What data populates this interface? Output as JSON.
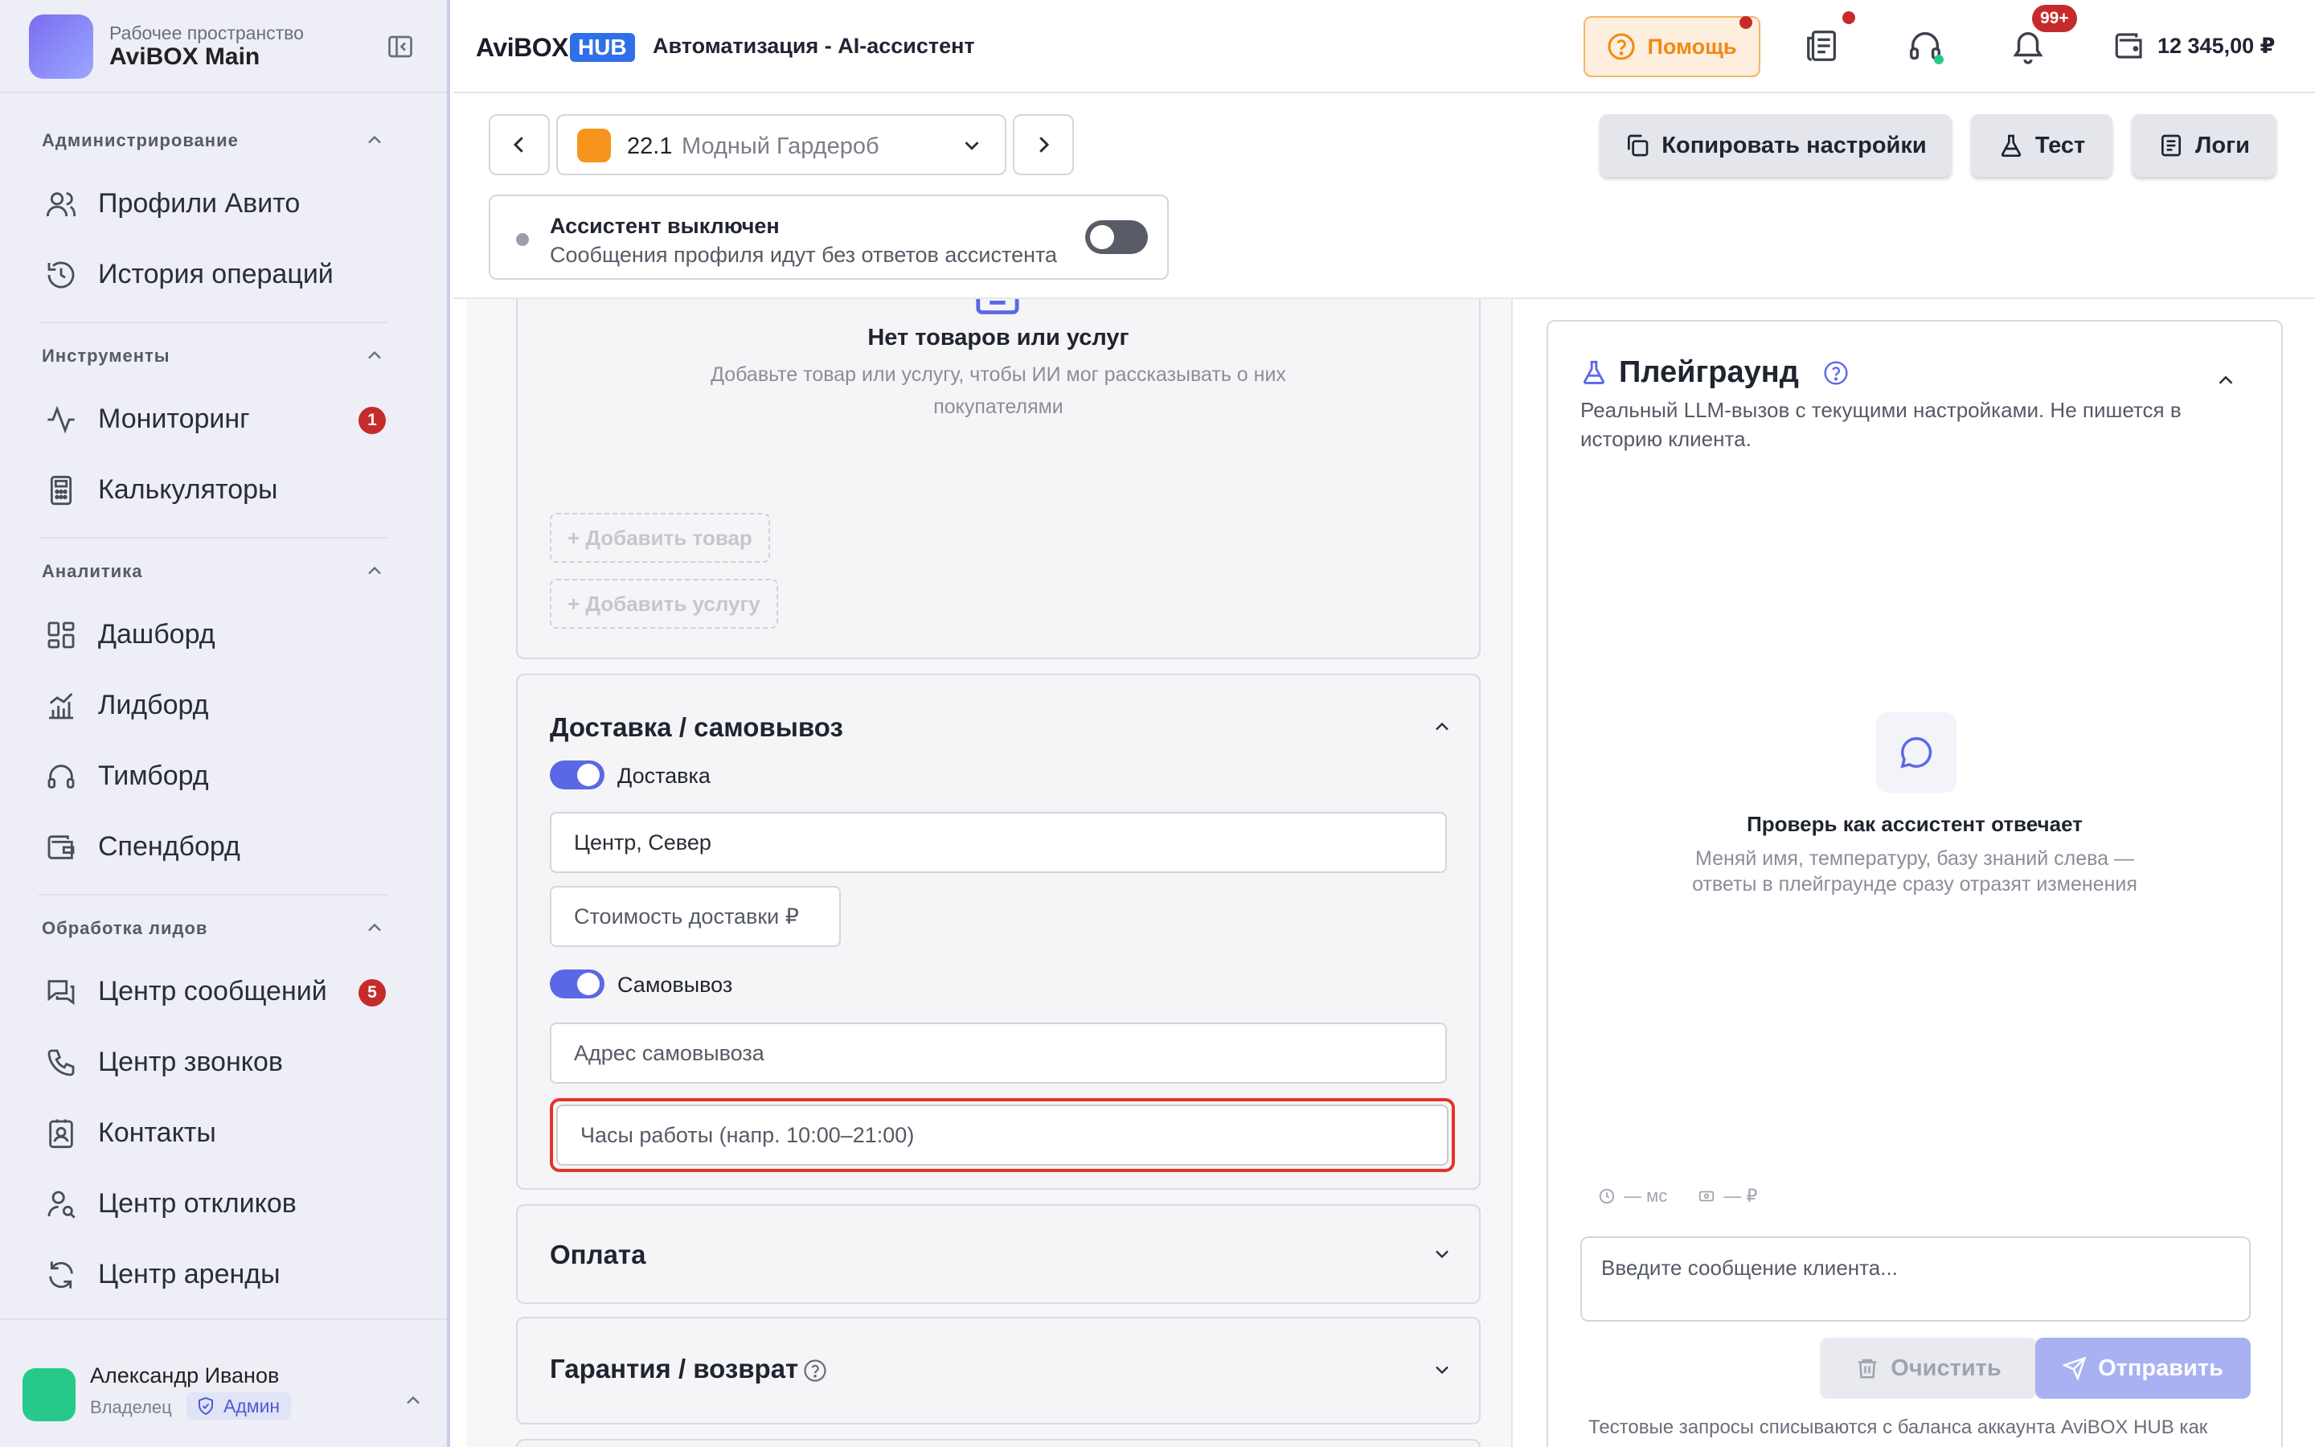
{
  "workspace": {
    "subtitle": "Рабочее пространство",
    "name": "AviBOX Main"
  },
  "sidebar": {
    "groups": [
      {
        "title": "Администрирование",
        "items": [
          {
            "label": "Профили Авито",
            "icon": "users-icon"
          },
          {
            "label": "История операций",
            "icon": "history-icon"
          }
        ]
      },
      {
        "title": "Инструменты",
        "items": [
          {
            "label": "Мониторинг",
            "icon": "pulse-icon",
            "badge": "1"
          },
          {
            "label": "Калькуляторы",
            "icon": "calculator-icon"
          }
        ]
      },
      {
        "title": "Аналитика",
        "items": [
          {
            "label": "Дашборд",
            "icon": "grid-icon"
          },
          {
            "label": "Лидборд",
            "icon": "chart-icon"
          },
          {
            "label": "Тимборд",
            "icon": "headset-icon"
          },
          {
            "label": "Спендборд",
            "icon": "wallet-icon"
          }
        ]
      },
      {
        "title": "Обработка лидов",
        "items": [
          {
            "label": "Центр сообщений",
            "icon": "chat-icon",
            "badge": "5"
          },
          {
            "label": "Центр звонков",
            "icon": "phone-icon"
          },
          {
            "label": "Контакты",
            "icon": "contacts-icon"
          },
          {
            "label": "Центр откликов",
            "icon": "user-check-icon"
          },
          {
            "label": "Центр аренды",
            "icon": "refresh-icon"
          }
        ]
      }
    ]
  },
  "user": {
    "name": "Александр Иванов",
    "role": "Владелец",
    "badge": "Админ"
  },
  "header": {
    "brand_avi": "AviBOX",
    "brand_hub": "HUB",
    "title": "Автоматизация - AI-ассистент",
    "help": "Помощь",
    "notifications_badge": "99+",
    "balance": "12 345,00 ₽"
  },
  "toolbar": {
    "profile_num": "22.1",
    "profile_name": "Модный Гардероб",
    "copy": "Копировать настройки",
    "test": "Тест",
    "logs": "Логи"
  },
  "assistant": {
    "title": "Ассистент выключен",
    "desc": "Сообщения профиля идут без ответов ассистента",
    "enabled": false
  },
  "products": {
    "empty_title": "Нет товаров или услуг",
    "empty_desc": "Добавьте товар или услугу, чтобы ИИ мог рассказывать о них покупателями",
    "add_product": "+ Добавить товар",
    "add_service": "+ Добавить услугу"
  },
  "delivery": {
    "title": "Доставка / самовывоз",
    "delivery_label": "Доставка",
    "delivery_enabled": true,
    "zones_value": "Центр, Север",
    "cost_placeholder": "Стоимость доставки ₽",
    "pickup_label": "Самовывоз",
    "pickup_enabled": true,
    "address_placeholder": "Адрес самовывоза",
    "hours_placeholder": "Часы работы (напр. 10:00–21:00)"
  },
  "payment": {
    "title": "Оплата"
  },
  "warranty": {
    "title": "Гарантия / возврат"
  },
  "playground": {
    "title": "Плейграунд",
    "desc": "Реальный LLM-вызов с текущими настройками. Не пишется в историю клиента.",
    "empty_title": "Проверь как ассистент отвечает",
    "empty_desc": "Меняй имя, температуру, базу знаний слева — ответы в плейграунде сразу отразят изменения",
    "stat_time": "— мс",
    "stat_cost": "— ₽",
    "input_placeholder": "Введите сообщение клиента...",
    "clear": "Очистить",
    "send": "Отправить",
    "note": "Тестовые запросы списываются с баланса аккаунта AviBOX HUB как"
  }
}
